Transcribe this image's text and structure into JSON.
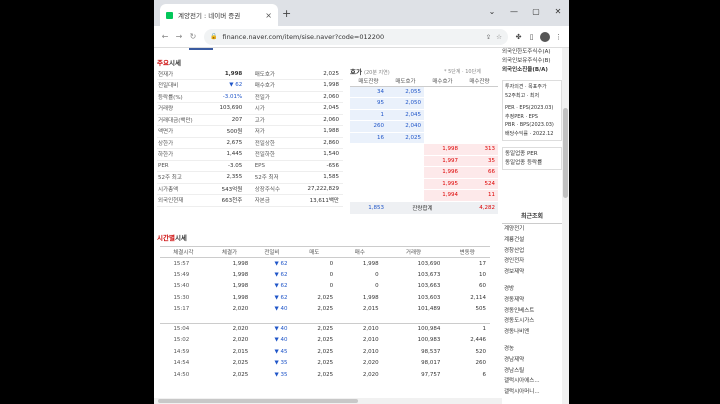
{
  "tab": {
    "title": "계양전기 : 네이버 증권",
    "close": "×"
  },
  "newtab": "+",
  "window": {
    "min": "⌄",
    "minimize": "—",
    "restore": "▢",
    "close": "✕"
  },
  "url": "finance.naver.com/item/sise.naver?code=012200",
  "summary": {
    "title_red": "주요",
    "title": "시세",
    "rows": [
      [
        "현재가",
        "1,998",
        "매도호가",
        "2,025"
      ],
      [
        "전일대비",
        "▼ 62",
        "매수호가",
        "1,998"
      ],
      [
        "등락률(%)",
        "-3.01%",
        "전일가",
        "2,060"
      ],
      [
        "거래량",
        "103,690",
        "시가",
        "2,045"
      ],
      [
        "거래대금(백만)",
        "207",
        "고가",
        "2,060"
      ],
      [
        "액면가",
        "500원",
        "저가",
        "1,988"
      ],
      [
        "상한가",
        "2,675",
        "전일상한",
        "2,860"
      ],
      [
        "하한가",
        "1,445",
        "전일하한",
        "1,540"
      ],
      [
        "PER",
        "-3.05",
        "EPS",
        "-656"
      ],
      [
        "52주 최고",
        "2,355",
        "52주 최저",
        "1,585"
      ],
      [
        "시가총액",
        "543억원",
        "상장주식수",
        "27,222,829"
      ],
      [
        "외국인현재",
        "663천주",
        "자본금",
        "13,611백만"
      ]
    ]
  },
  "orderbook": {
    "title": "호가",
    "subtitle": "(20분 지연)",
    "options": "* 5단계 · 10단계",
    "headers": [
      "매도잔량",
      "매도호가",
      "매수호가",
      "매수잔량"
    ],
    "asks": [
      [
        "34",
        "2,055"
      ],
      [
        "95",
        "2,050"
      ],
      [
        "1",
        "2,045"
      ],
      [
        "260",
        "2,040"
      ],
      [
        "16",
        "2,025"
      ]
    ],
    "bids": [
      [
        "1,998",
        "313"
      ],
      [
        "1,997",
        "35"
      ],
      [
        "1,996",
        "66"
      ],
      [
        "1,995",
        "524"
      ],
      [
        "1,994",
        "11"
      ]
    ],
    "sum_ask": "1,853",
    "sum_label": "잔량합계",
    "sum_bid": "4,282"
  },
  "time": {
    "title_red": "시간별",
    "title": "시세",
    "headers": [
      "체결시각",
      "체결가",
      "전일비",
      "매도",
      "매수",
      "거래량",
      "변동량"
    ],
    "rows": [
      [
        "15:57",
        "1,998",
        "62",
        "0",
        "1,998",
        "103,690",
        "17"
      ],
      [
        "15:49",
        "1,998",
        "62",
        "0",
        "0",
        "103,673",
        "10"
      ],
      [
        "15:40",
        "1,998",
        "62",
        "0",
        "0",
        "103,663",
        "60"
      ],
      [
        "15:30",
        "1,998",
        "62",
        "2,025",
        "1,998",
        "103,603",
        "2,114"
      ],
      [
        "15:17",
        "2,020",
        "40",
        "2,025",
        "2,015",
        "101,489",
        "505"
      ],
      [
        "15:04",
        "2,020",
        "40",
        "2,025",
        "2,010",
        "100,984",
        "1"
      ],
      [
        "15:02",
        "2,020",
        "40",
        "2,025",
        "2,010",
        "100,983",
        "2,446"
      ],
      [
        "14:59",
        "2,015",
        "45",
        "2,025",
        "2,010",
        "98,537",
        "520"
      ],
      [
        "14:54",
        "2,025",
        "35",
        "2,025",
        "2,020",
        "98,017",
        "260"
      ],
      [
        "14:50",
        "2,025",
        "35",
        "2,025",
        "2,020",
        "97,757",
        "6"
      ]
    ]
  },
  "side": {
    "top": [
      "외국인한도주식수(A)",
      "외국인보유주식수(B)",
      "외국인소진율(B/A)"
    ],
    "box1": [
      "투자의견 · 목표주가",
      "52주최고 · 최저"
    ],
    "box1b": [
      "PER · EPS(2023.03)",
      "추정PER · EPS",
      "PBR · BPS(2023.03)",
      "배당수익률 · 2022.12"
    ],
    "box2": [
      "동일업종 PER",
      "동일업종 등락률"
    ],
    "recent_title": "최근조회",
    "groups": [
      [
        "계양전기",
        "계룡건설",
        "경창산업",
        "경인전자",
        "경보제약"
      ],
      [
        "경방",
        "경동제약",
        "경동인베스트",
        "경동도시가스",
        "경동나비엔"
      ],
      [
        "경농",
        "경남제약",
        "경남스틸",
        "갤럭시아에스...",
        "갤럭시아머니..."
      ]
    ]
  }
}
